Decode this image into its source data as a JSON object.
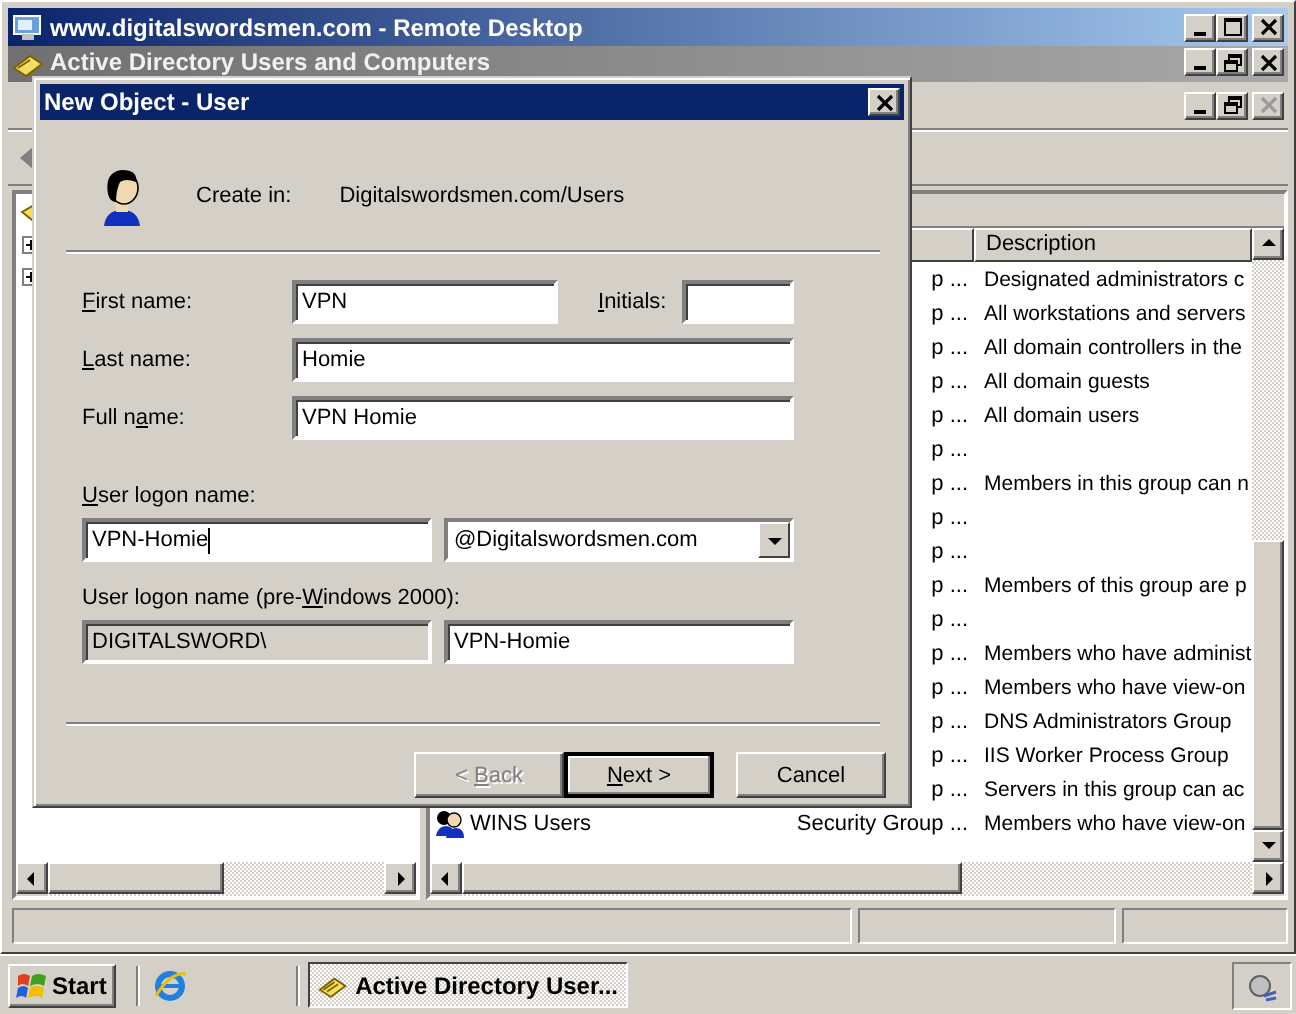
{
  "remote_desktop": {
    "title": "www.digitalswordsmen.com - Remote Desktop"
  },
  "app_window": {
    "title": "Active Directory Users and Computers",
    "active": false
  },
  "list": {
    "columns": [
      "Description"
    ],
    "rows": [
      {
        "type": "p ...",
        "description": "Designated administrators c"
      },
      {
        "type": "p ...",
        "description": "All workstations and servers"
      },
      {
        "type": "p ...",
        "description": "All domain controllers in the"
      },
      {
        "type": "p ...",
        "description": "All domain guests"
      },
      {
        "type": "p ...",
        "description": "All domain users"
      },
      {
        "type": "p ..."
      },
      {
        "type": "p ...",
        "description": "Members in this group can n"
      },
      {
        "type": "p ..."
      },
      {
        "type": "p ..."
      },
      {
        "type": "p ...",
        "description": "Members of this group are p"
      },
      {
        "type": "p ..."
      },
      {
        "type": "p ...",
        "description": "Members who have administ"
      },
      {
        "type": "p ...",
        "description": "Members who have view-on"
      },
      {
        "type": "p ...",
        "description": "DNS Administrators Group"
      },
      {
        "type": "p ...",
        "description": "IIS Worker Process Group"
      },
      {
        "type": "p ...",
        "description": "Servers in this group can ac"
      },
      {
        "name": "WINS Users",
        "type": "Security Group ...",
        "description": "Members who have view-on"
      }
    ]
  },
  "dialog": {
    "title": "New Object - User",
    "create_in_label": "Create in:",
    "create_in_path": "Digitalswordsmen.com/Users",
    "first_name": {
      "label_key": "F",
      "label_rest": "irst name:",
      "value": "VPN"
    },
    "initials": {
      "label_key": "I",
      "label_rest": "nitials:"
    },
    "last_name": {
      "label_key": "L",
      "label_rest": "ast name:",
      "value": "Homie"
    },
    "full_name": {
      "label_before": "Full n",
      "label_key": "a",
      "label_rest": "me:",
      "value": "VPN Homie"
    },
    "logon_name": {
      "label_key": "U",
      "label_rest": "ser logon name:",
      "value": "VPN-Homie",
      "focused": true,
      "domain": "@Digitalswordsmen.com"
    },
    "pre2000": {
      "label_before": "User logon name (pre-",
      "label_key": "W",
      "label_rest": "indows 2000):",
      "domain": "DIGITALSWORD\\",
      "value": "VPN-Homie"
    },
    "buttons": [
      {
        "before": "< ",
        "key": "B",
        "rest": "ack",
        "disabled": true,
        "default": false
      },
      {
        "key": "N",
        "rest": "ext >",
        "disabled": false,
        "default": true
      },
      {
        "rest": "Cancel",
        "disabled": false,
        "default": false
      }
    ]
  },
  "taskbar": {
    "start": "Start",
    "tasks": [
      {
        "label": "Active Directory User...",
        "selected": true
      }
    ]
  }
}
